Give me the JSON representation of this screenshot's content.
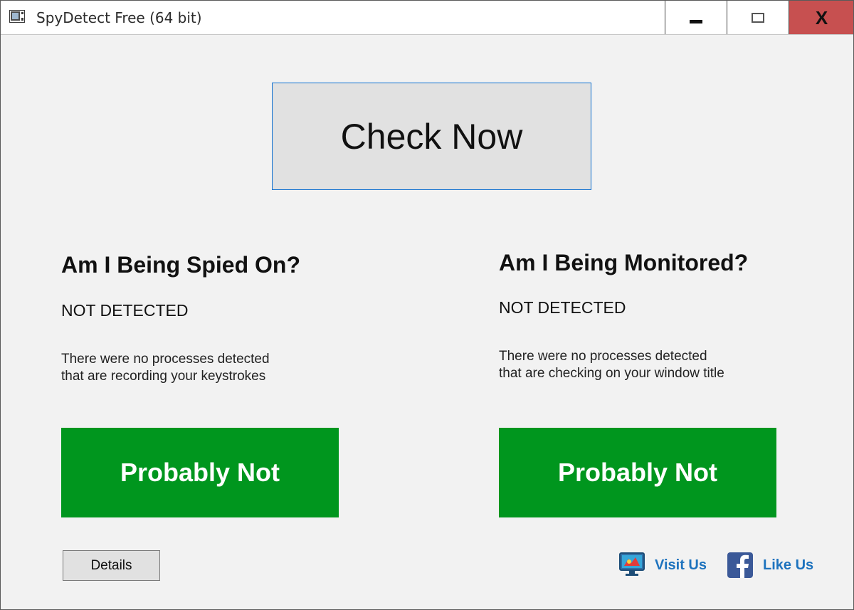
{
  "window": {
    "title": "SpyDetect Free (64 bit)",
    "close_symbol": "X"
  },
  "main": {
    "check_button_label": "Check Now"
  },
  "keylogger_panel": {
    "heading": "Am I Being Spied On?",
    "status": "NOT DETECTED",
    "description_line1": "There were no processes detected",
    "description_line2": "that are recording your keystrokes",
    "verdict": "Probably Not"
  },
  "monitor_panel": {
    "heading": "Am I Being Monitored?",
    "status": "NOT DETECTED",
    "description_line1": "There were no processes detected",
    "description_line2": "that are checking on your window title",
    "verdict": "Probably Not"
  },
  "footer": {
    "details_label": "Details",
    "visit_label": "Visit Us",
    "like_label": "Like Us"
  },
  "colors": {
    "verdict_green": "#00961e",
    "close_red": "#c75050",
    "link_blue": "#1e73be",
    "check_border": "#0b6ed0"
  },
  "icons": {
    "app": "app-window-icon",
    "visit": "monitor-icon",
    "like": "facebook-icon"
  }
}
